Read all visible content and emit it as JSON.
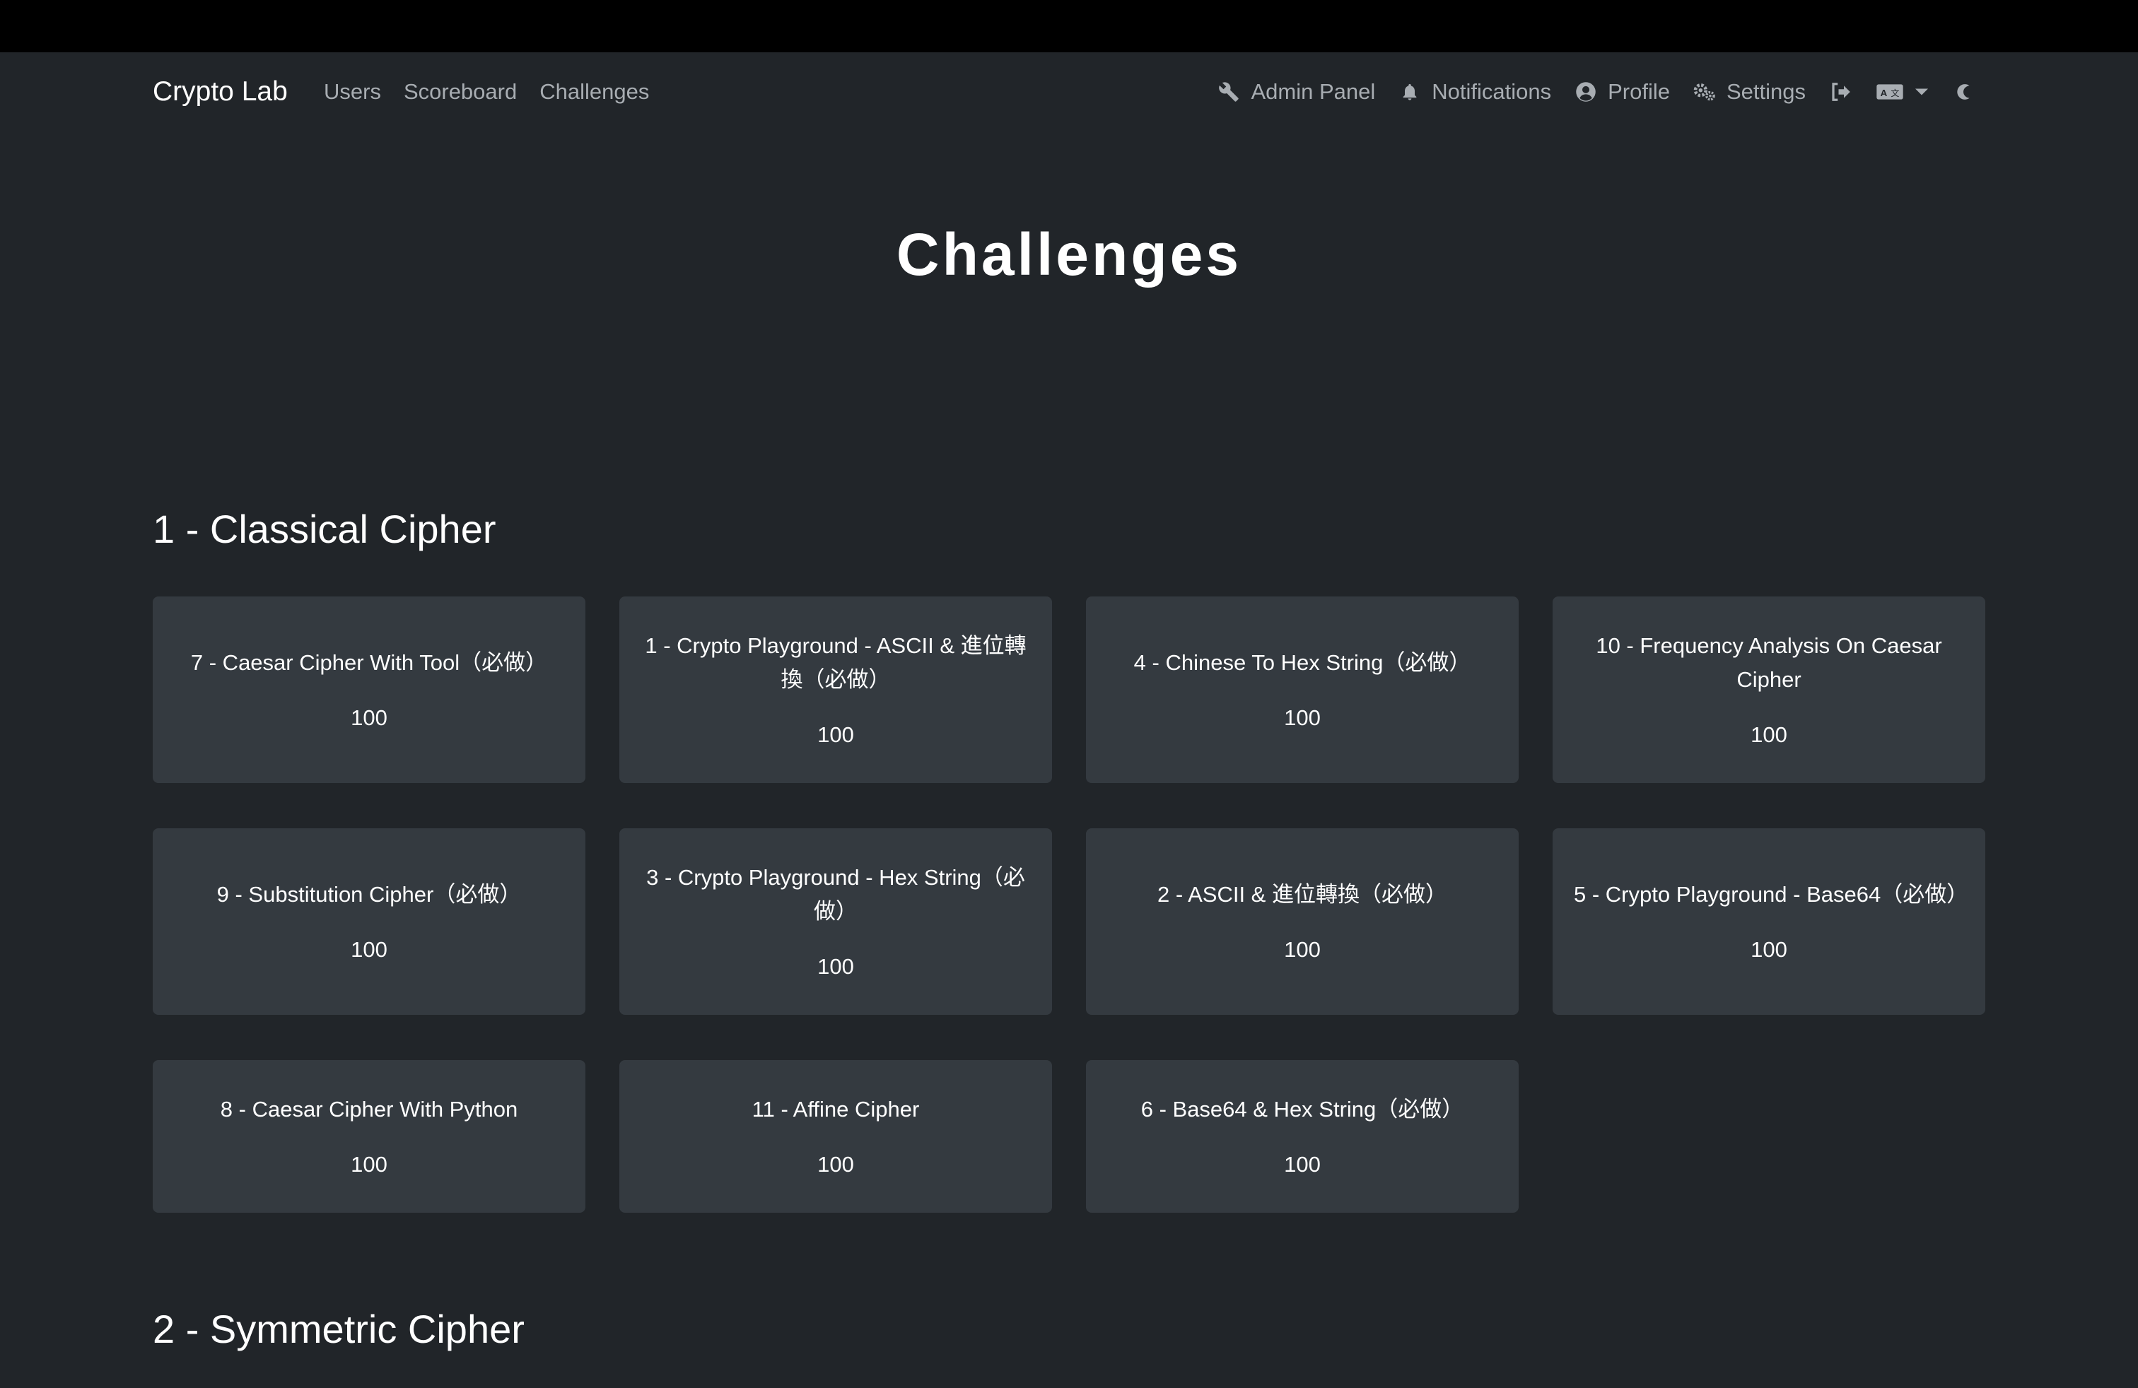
{
  "navbar": {
    "brand": "Crypto Lab",
    "left_links": [
      "Users",
      "Scoreboard",
      "Challenges"
    ],
    "admin_panel": "Admin Panel",
    "notifications": "Notifications",
    "profile": "Profile",
    "settings": "Settings",
    "icons": [
      "wrench-icon",
      "bell-icon",
      "user-circle-icon",
      "gears-icon",
      "logout-icon",
      "language-icon",
      "caret-down-icon",
      "moon-icon"
    ]
  },
  "page": {
    "title": "Challenges"
  },
  "categories": [
    {
      "title": "1 - Classical Cipher",
      "challenges": [
        {
          "name": "7 - Caesar Cipher With Tool（必做）",
          "value": "100"
        },
        {
          "name": "1 - Crypto Playground - ASCII & 進位轉換（必做）",
          "value": "100"
        },
        {
          "name": "4 - Chinese To Hex String（必做）",
          "value": "100"
        },
        {
          "name": "10 - Frequency Analysis On Caesar Cipher",
          "value": "100"
        },
        {
          "name": "9 - Substitution Cipher（必做）",
          "value": "100"
        },
        {
          "name": "3 - Crypto Playground - Hex String（必做）",
          "value": "100"
        },
        {
          "name": "2 - ASCII & 進位轉換（必做）",
          "value": "100"
        },
        {
          "name": "5 - Crypto Playground - Base64（必做）",
          "value": "100"
        },
        {
          "name": "8 - Caesar Cipher With Python",
          "value": "100"
        },
        {
          "name": "11 - Affine Cipher",
          "value": "100"
        },
        {
          "name": "6 - Base64 & Hex String（必做）",
          "value": "100"
        }
      ]
    },
    {
      "title": "2 - Symmetric Cipher",
      "challenges": []
    }
  ],
  "colors": {
    "background": "#212529",
    "card": "#343a40",
    "nav_link": "#a8adb2",
    "top_bar": "#000000"
  }
}
